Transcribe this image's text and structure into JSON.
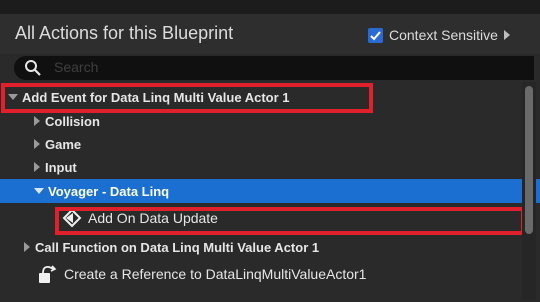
{
  "header": {
    "title": "All Actions for this Blueprint",
    "context_sensitive_label": "Context Sensitive",
    "context_sensitive_checked": true
  },
  "search": {
    "placeholder": "Search",
    "value": ""
  },
  "tree": {
    "items": [
      {
        "label": "Add Event for Data Linq Multi Value Actor 1",
        "expanded": true,
        "level": 0
      },
      {
        "label": "Collision",
        "expanded": false,
        "level": 1
      },
      {
        "label": "Game",
        "expanded": false,
        "level": 1
      },
      {
        "label": "Input",
        "expanded": false,
        "level": 1
      },
      {
        "label": "Voyager - Data Linq",
        "expanded": true,
        "level": 1,
        "selected": true
      },
      {
        "label": "Add On Data Update",
        "level": 2,
        "icon": "event-diamond-icon"
      },
      {
        "label": "Call Function on Data Linq Multi Value Actor 1",
        "expanded": false,
        "level": 0
      },
      {
        "label": "Create a Reference to DataLinqMultiValueActor1",
        "level": 0,
        "icon": "reference-icon"
      }
    ]
  },
  "colors": {
    "selection": "#1a6fd0",
    "highlight_box": "#e0202b",
    "checkbox": "#2a6ad3"
  }
}
